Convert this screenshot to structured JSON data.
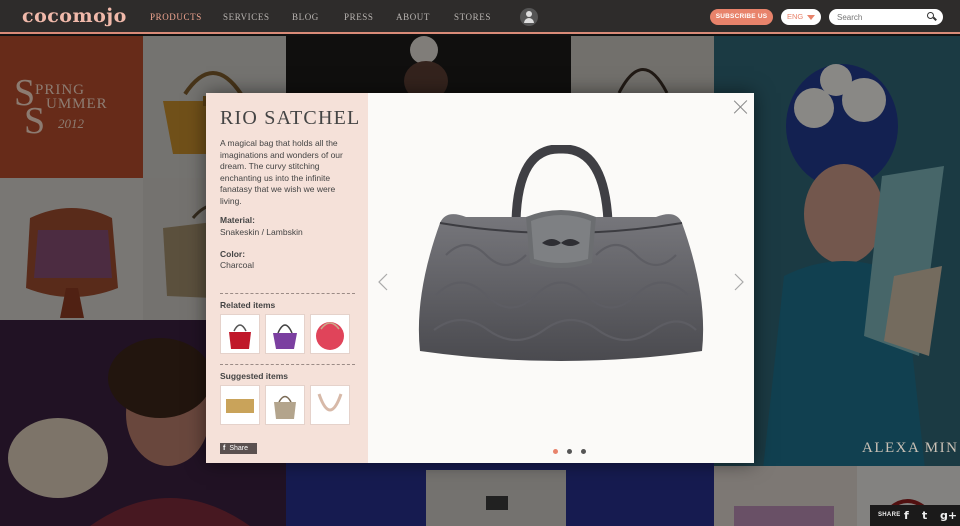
{
  "header": {
    "logo": "cocomojo",
    "nav": [
      {
        "label": "PRODUCTS",
        "active": true
      },
      {
        "label": "SERVICES",
        "active": false
      },
      {
        "label": "BLOG",
        "active": false
      },
      {
        "label": "PRESS",
        "active": false
      },
      {
        "label": "ABOUT",
        "active": false
      },
      {
        "label": "STORES",
        "active": false
      }
    ],
    "profile_icon": "user-icon",
    "subscribe_label": "SUBSCRIBE US",
    "language": "ENG",
    "search_placeholder": "Search",
    "accent_color": "#e8836b"
  },
  "background": {
    "spring_line1": "PRING",
    "spring_line2": "UMMER",
    "spring_cap": "S",
    "spring_year": "2012",
    "alexa_text": "ALEXA MIN"
  },
  "modal": {
    "title": "RIO SATCHEL",
    "description": "A magical bag that holds all the imaginations and wonders of our dream. The curvy stitching enchanting us into the infinite fanatasy that we wish we were living.",
    "material_label": "Material:",
    "material_value": "Snakeskin / Lambskin",
    "color_label": "Color:",
    "color_value": "Charcoal",
    "related_label": "Related items",
    "suggested_label": "Suggested items",
    "share_label": "Share",
    "share_icon": "facebook-icon",
    "close_icon": "close-icon",
    "prev_icon": "chevron-left-icon",
    "next_icon": "chevron-right-icon",
    "slide_count": 3,
    "active_slide": 1
  },
  "footer": {
    "share_label": "SHARE",
    "icons": [
      "facebook-icon",
      "twitter-icon",
      "google-plus-icon"
    ],
    "glyphs": [
      "f",
      "t",
      "g+"
    ]
  }
}
